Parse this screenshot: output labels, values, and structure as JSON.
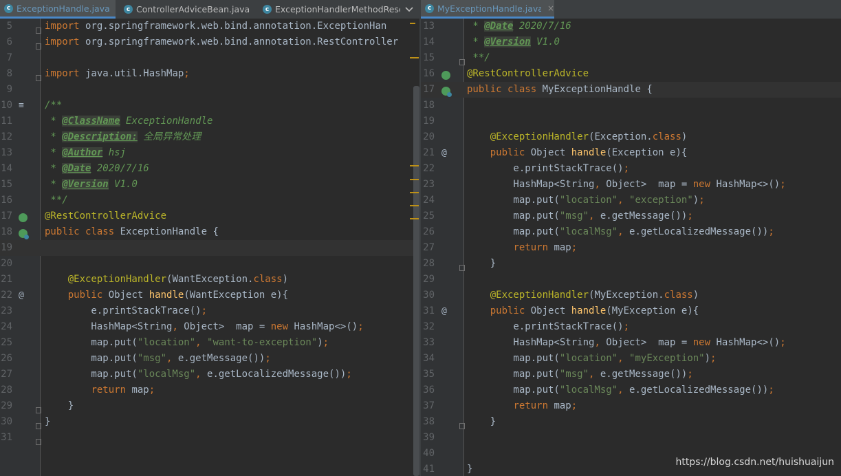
{
  "left_editor": {
    "tabs": [
      {
        "label": "ExceptionHandle.java",
        "icon": "class-icon",
        "active": true,
        "closable": false
      },
      {
        "label": "ControllerAdviceBean.java",
        "icon": "class-icon",
        "active": false,
        "closable": false
      },
      {
        "label": "ExceptionHandlerMethodResolv",
        "icon": "class-icon",
        "active": false,
        "closable": false
      }
    ],
    "overflow_icon": "chevron-down-icon",
    "current_line": "19",
    "lines": [
      {
        "n": "5",
        "text": "import org.springframework.web.bind.annotation.ExceptionHan"
      },
      {
        "n": "6",
        "text": "import org.springframework.web.bind.annotation.RestController"
      },
      {
        "n": "7",
        "text": ""
      },
      {
        "n": "8",
        "text": "import java.util.HashMap;"
      },
      {
        "n": "9",
        "text": ""
      },
      {
        "n": "10",
        "text": "/**"
      },
      {
        "n": "11",
        "text": " * @ClassName ExceptionHandle"
      },
      {
        "n": "12",
        "text": " * @Description: 全局异常处理"
      },
      {
        "n": "13",
        "text": " * @Author hsj"
      },
      {
        "n": "14",
        "text": " * @Date 2020/7/16"
      },
      {
        "n": "15",
        "text": " * @Version V1.0"
      },
      {
        "n": "16",
        "text": " **/"
      },
      {
        "n": "17",
        "text": "@RestControllerAdvice"
      },
      {
        "n": "18",
        "text": "public class ExceptionHandle {"
      },
      {
        "n": "19",
        "text": ""
      },
      {
        "n": "20",
        "text": ""
      },
      {
        "n": "21",
        "text": "    @ExceptionHandler(WantException.class)"
      },
      {
        "n": "22",
        "text": "    public Object handle(WantException e){"
      },
      {
        "n": "23",
        "text": "        e.printStackTrace();"
      },
      {
        "n": "24",
        "text": "        HashMap<String, Object>  map = new HashMap<>();"
      },
      {
        "n": "25",
        "text": "        map.put(\"location\", \"want-to-exception\");"
      },
      {
        "n": "26",
        "text": "        map.put(\"msg\", e.getMessage());"
      },
      {
        "n": "27",
        "text": "        map.put(\"localMsg\", e.getLocalizedMessage());"
      },
      {
        "n": "28",
        "text": "        return map;"
      },
      {
        "n": "29",
        "text": "    }"
      },
      {
        "n": "30",
        "text": "}"
      },
      {
        "n": "31",
        "text": ""
      }
    ]
  },
  "right_editor": {
    "tabs": [
      {
        "label": "MyExceptionHandle.java",
        "icon": "class-icon",
        "active": true,
        "closable": true
      }
    ],
    "close_glyph": "×",
    "current_line": "17",
    "lines": [
      {
        "n": "13",
        "text": " * @Date 2020/7/16"
      },
      {
        "n": "14",
        "text": " * @Version V1.0"
      },
      {
        "n": "15",
        "text": " **/"
      },
      {
        "n": "16",
        "text": "@RestControllerAdvice"
      },
      {
        "n": "17",
        "text": "public class MyExceptionHandle {"
      },
      {
        "n": "18",
        "text": ""
      },
      {
        "n": "19",
        "text": ""
      },
      {
        "n": "20",
        "text": "    @ExceptionHandler(Exception.class)"
      },
      {
        "n": "21",
        "text": "    public Object handle(Exception e){"
      },
      {
        "n": "22",
        "text": "        e.printStackTrace();"
      },
      {
        "n": "23",
        "text": "        HashMap<String, Object>  map = new HashMap<>();"
      },
      {
        "n": "24",
        "text": "        map.put(\"location\", \"exception\");"
      },
      {
        "n": "25",
        "text": "        map.put(\"msg\", e.getMessage());"
      },
      {
        "n": "26",
        "text": "        map.put(\"localMsg\", e.getLocalizedMessage());"
      },
      {
        "n": "27",
        "text": "        return map;"
      },
      {
        "n": "28",
        "text": "    }"
      },
      {
        "n": "29",
        "text": ""
      },
      {
        "n": "30",
        "text": "    @ExceptionHandler(MyException.class)"
      },
      {
        "n": "31",
        "text": "    public Object handle(MyException e){"
      },
      {
        "n": "32",
        "text": "        e.printStackTrace();"
      },
      {
        "n": "33",
        "text": "        HashMap<String, Object>  map = new HashMap<>();"
      },
      {
        "n": "34",
        "text": "        map.put(\"location\", \"myException\");"
      },
      {
        "n": "35",
        "text": "        map.put(\"msg\", e.getMessage());"
      },
      {
        "n": "36",
        "text": "        map.put(\"localMsg\", e.getLocalizedMessage());"
      },
      {
        "n": "37",
        "text": "        return map;"
      },
      {
        "n": "38",
        "text": "    }"
      },
      {
        "n": "39",
        "text": ""
      },
      {
        "n": "40",
        "text": ""
      },
      {
        "n": "41",
        "text": "}"
      }
    ]
  },
  "watermark": "https://blog.csdn.net/huishuaijun",
  "colors": {
    "background": "#2b2b2b",
    "gutter": "#313335",
    "keyword": "#cc7832",
    "annotation": "#bbb529",
    "string": "#6a8759",
    "method": "#ffc66d",
    "doc_comment": "#629755",
    "text": "#a9b7c6",
    "line_number": "#606366",
    "active_tab_text": "#6897bb",
    "accent": "#4a88c7"
  }
}
